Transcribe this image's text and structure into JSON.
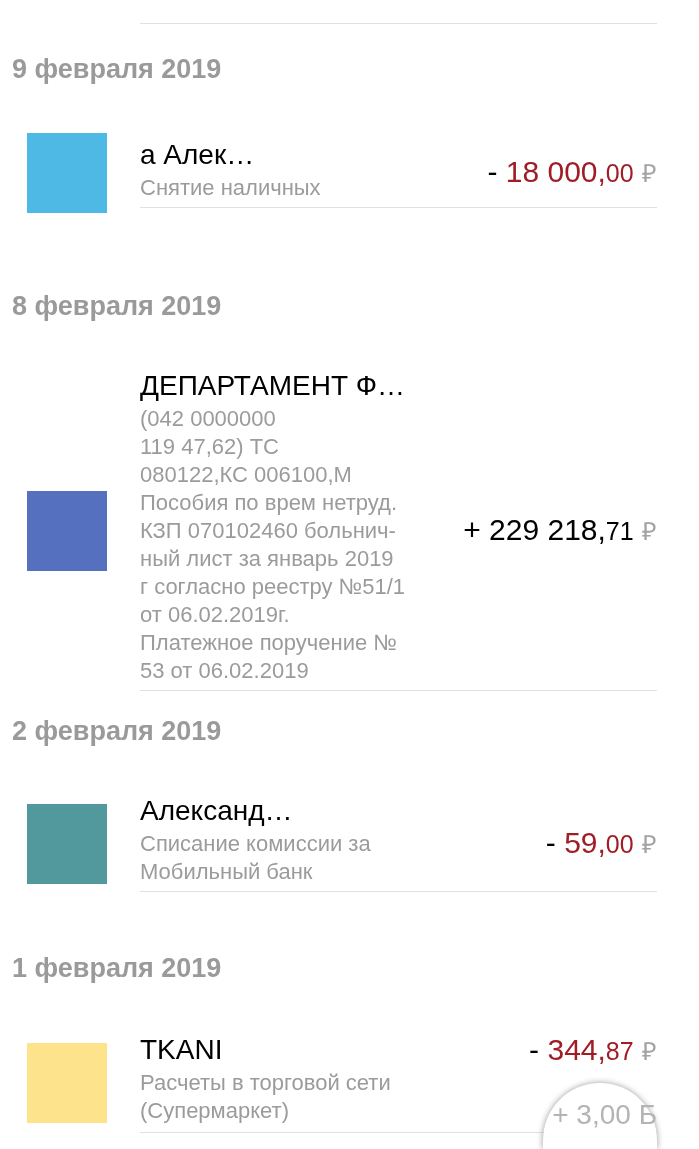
{
  "groups": [
    {
      "date": "9 февраля 2019",
      "transactions": [
        {
          "title": "а Алек…",
          "subtitle_lines": [
            "Снятие наличных"
          ],
          "color": "#4fb9e6",
          "amount": {
            "kind": "debit",
            "sign": "-",
            "main": "18 000,",
            "fraction": "00",
            "currency": "₽"
          }
        }
      ]
    },
    {
      "date": "8 февраля 2019",
      "transactions": [
        {
          "title": "ДЕПАРТАМЕНТ Ф…",
          "subtitle_lines": [
            "(042 0000000",
            "119 47,62) ТС",
            "080122,КС 006100,М",
            "Пособия по врем нетруд.",
            "КЗП 070102460 больнич-",
            "ный лист за январь 2019",
            "г согласно реестру №51/1",
            "от 06.02.2019г.",
            "Платежное поручение №",
            "53 от 06.02.2019"
          ],
          "color": "#5470bf",
          "amount": {
            "kind": "credit",
            "sign": "+",
            "main": "229 218,",
            "fraction": "71",
            "currency": "₽"
          }
        }
      ]
    },
    {
      "date": "2 февраля 2019",
      "transactions": [
        {
          "title": "Александ…",
          "subtitle_lines": [
            "Списание комиссии за",
            "Мобильный банк"
          ],
          "color": "#52999e",
          "amount": {
            "kind": "debit",
            "sign": "-",
            "main": "59,",
            "fraction": "00",
            "currency": "₽"
          }
        }
      ]
    },
    {
      "date": "1 февраля 2019",
      "transactions": [
        {
          "title": "TKANI",
          "subtitle_lines": [
            "Расчеты в торговой сети",
            "(Супермаркет)"
          ],
          "color": "#fde38b",
          "amount": {
            "kind": "debit",
            "sign": "-",
            "main": "344,",
            "fraction": "87",
            "currency": "₽"
          },
          "bonus": "+ 3,00 Б"
        }
      ]
    }
  ]
}
